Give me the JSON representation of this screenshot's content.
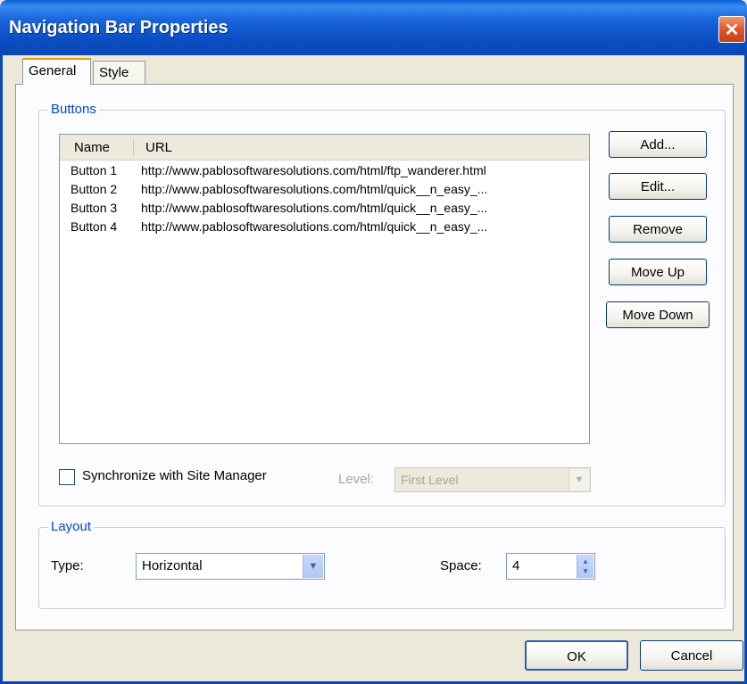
{
  "window": {
    "title": "Navigation Bar Properties",
    "close_glyph": "✕"
  },
  "tabs": [
    {
      "label": "General",
      "active": true
    },
    {
      "label": "Style",
      "active": false
    }
  ],
  "buttons_group": {
    "label": "Buttons",
    "columns": [
      "Name",
      "URL"
    ],
    "rows": [
      {
        "name": "Button 1",
        "url": "http://www.pablosoftwaresolutions.com/html/ftp_wanderer.html"
      },
      {
        "name": "Button 2",
        "url": "http://www.pablosoftwaresolutions.com/html/quick__n_easy_..."
      },
      {
        "name": "Button 3",
        "url": "http://www.pablosoftwaresolutions.com/html/quick__n_easy_..."
      },
      {
        "name": "Button 4",
        "url": "http://www.pablosoftwaresolutions.com/html/quick__n_easy_..."
      }
    ],
    "actions": {
      "add": "Add...",
      "edit": "Edit...",
      "remove": "Remove",
      "move_up": "Move Up",
      "move_down": "Move Down"
    },
    "sync_checkbox": {
      "label": "Synchronize with Site Manager",
      "checked": false
    },
    "level": {
      "label": "Level:",
      "value": "First Level",
      "enabled": false
    }
  },
  "layout_group": {
    "label": "Layout",
    "type_label": "Type:",
    "type_value": "Horizontal",
    "space_label": "Space:",
    "space_value": "4"
  },
  "footer": {
    "ok": "OK",
    "cancel": "Cancel"
  },
  "colors": {
    "titlebar": "#0a47b3",
    "group_label": "#0046d5",
    "dialog_bg": "#ece9d8"
  }
}
